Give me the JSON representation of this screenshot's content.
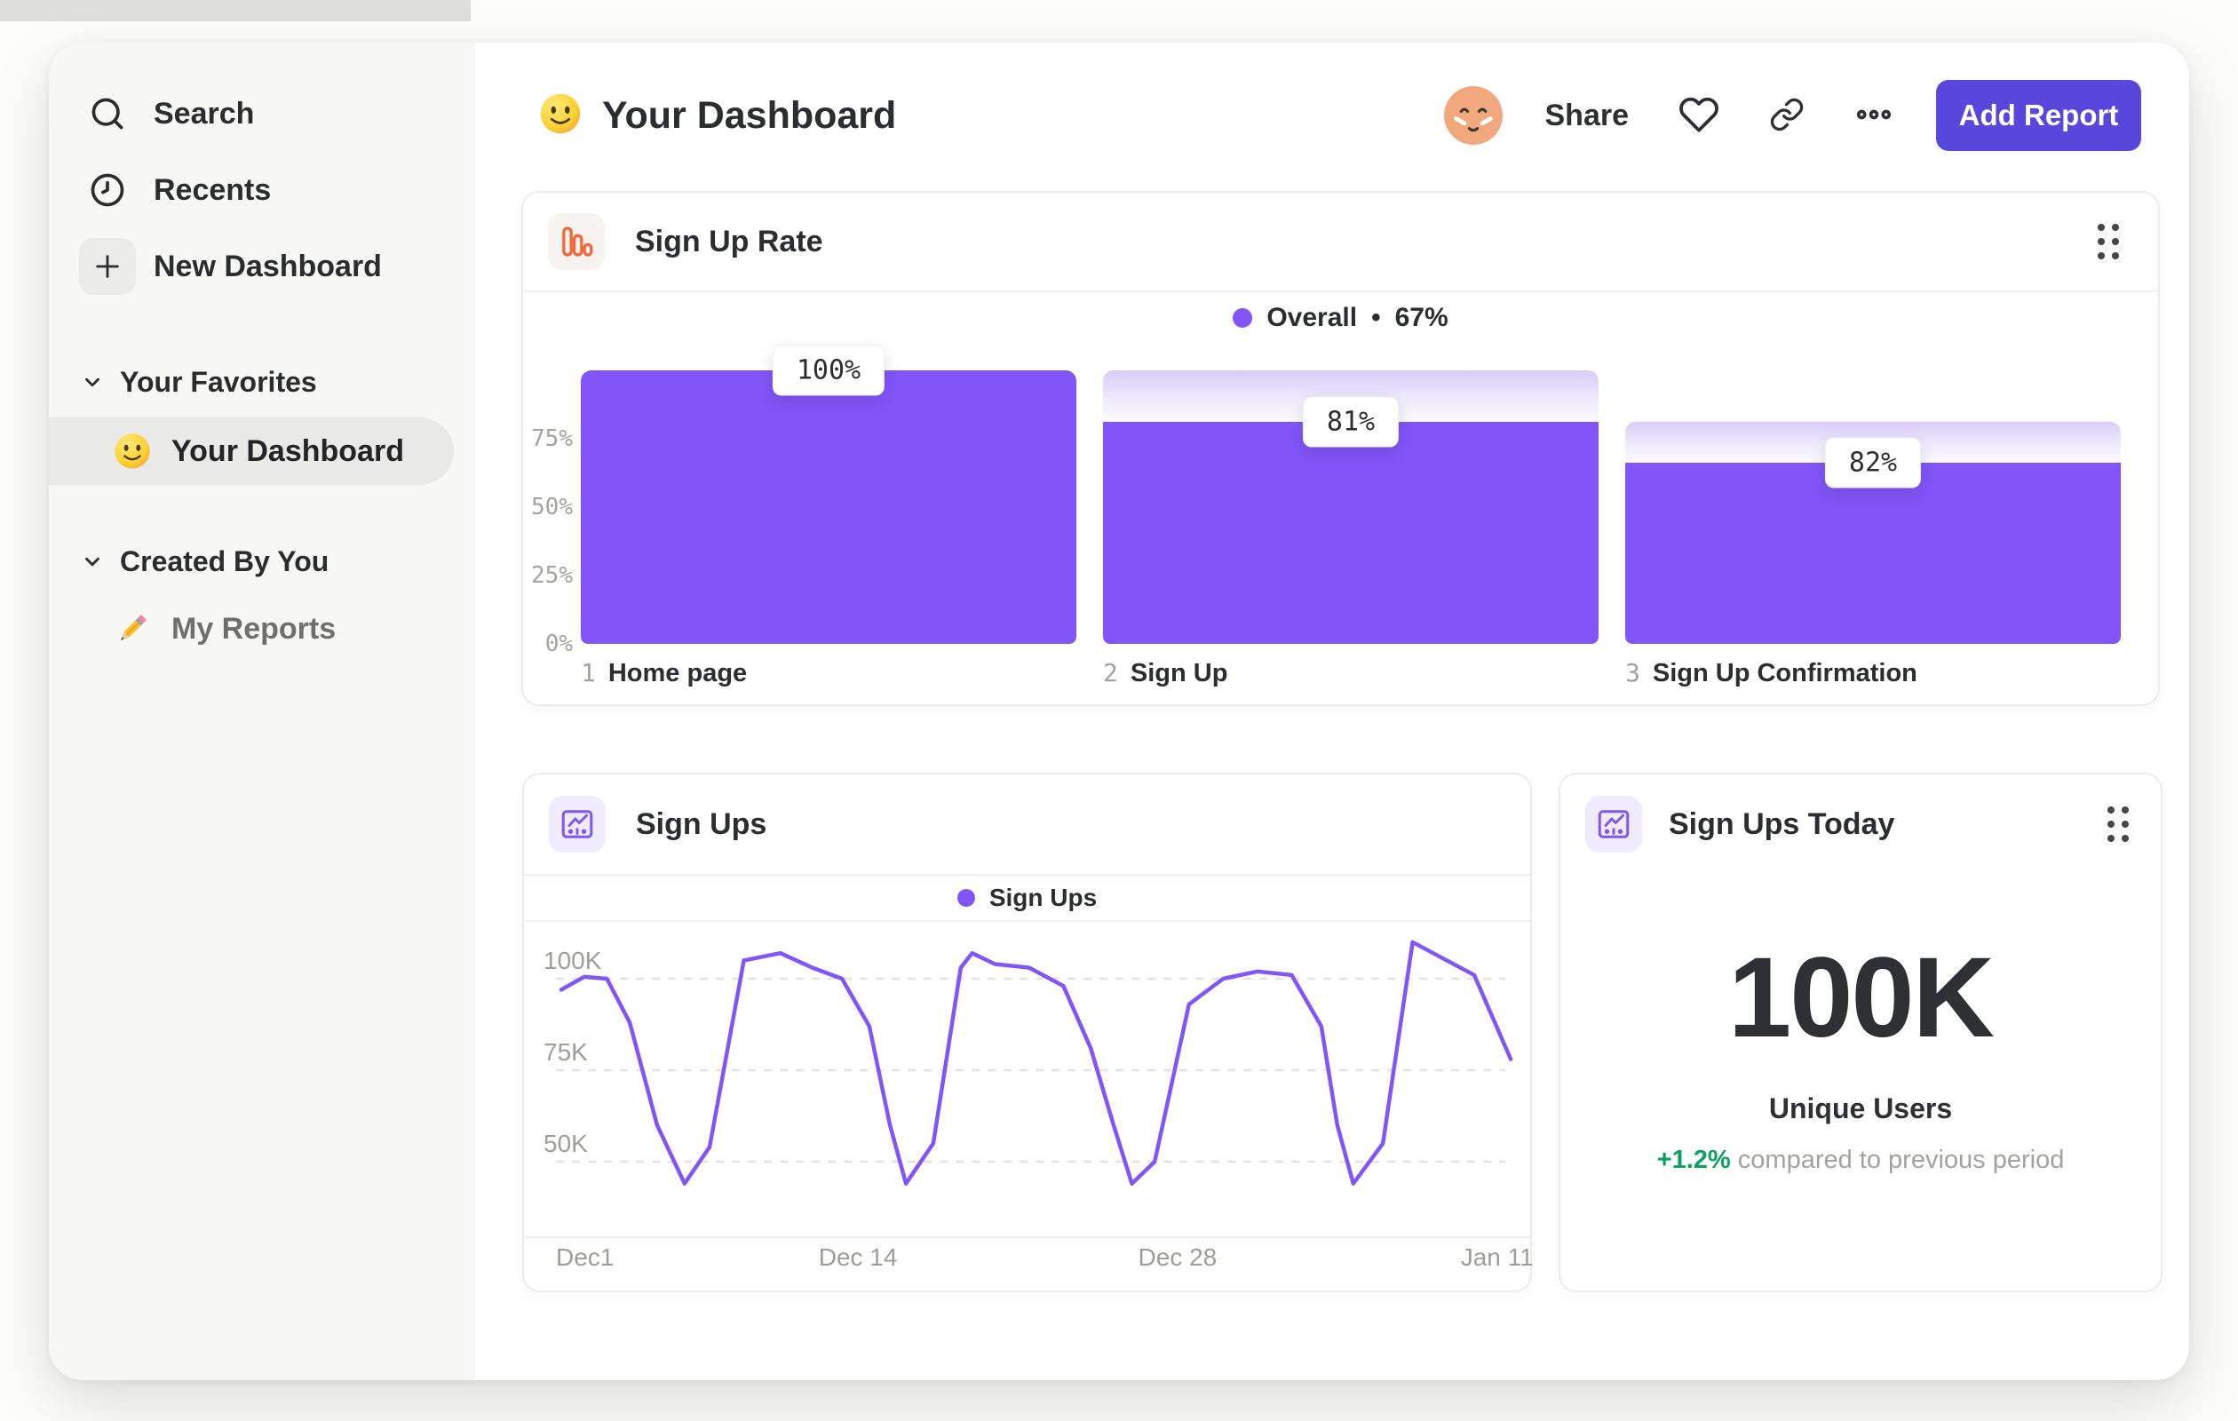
{
  "header": {
    "title": "Your Dashboard",
    "share_label": "Share",
    "add_report_label": "Add Report"
  },
  "sidebar": {
    "items": [
      {
        "label": "Search",
        "icon": "search-icon"
      },
      {
        "label": "Recents",
        "icon": "clock-icon"
      },
      {
        "label": "New Dashboard",
        "icon": "plus-icon"
      }
    ],
    "sections": [
      {
        "title": "Your Favorites",
        "items": [
          {
            "label": "Your Dashboard",
            "icon": "smiley-emoji",
            "selected": true
          }
        ]
      },
      {
        "title": "Created By You",
        "items": [
          {
            "label": "My Reports",
            "icon": "pencil-emoji",
            "selected": false
          }
        ]
      }
    ]
  },
  "cards": {
    "funnel": {
      "title": "Sign Up Rate",
      "legend": {
        "name": "Overall",
        "separator": "•",
        "value": "67%"
      }
    },
    "line": {
      "title": "Sign Ups",
      "legend": {
        "name": "Sign Ups"
      }
    },
    "metric": {
      "title": "Sign Ups Today",
      "value": "100K",
      "label": "Unique Users",
      "delta": "+1.2%",
      "delta_note": "compared to previous period"
    }
  },
  "chart_data": [
    {
      "type": "bar",
      "variant": "funnel",
      "title": "Sign Up Rate",
      "overall_conversion_pct": 67,
      "axis_max": 107,
      "y_ticks": [
        75,
        50,
        25,
        0
      ],
      "steps": [
        {
          "step": "1",
          "name": "Home page",
          "conversion_label": "100%",
          "abs_pct": 100,
          "prev_abs_pct": 100
        },
        {
          "step": "2",
          "name": "Sign Up",
          "conversion_label": "81%",
          "abs_pct": 81,
          "prev_abs_pct": 100
        },
        {
          "step": "3",
          "name": "Sign Up Confirmation",
          "conversion_label": "82%",
          "abs_pct": 66,
          "prev_abs_pct": 81
        }
      ]
    },
    {
      "type": "line",
      "title": "Sign Ups",
      "ylabel": "",
      "xlabel": "",
      "grid": "dashed-horizontal",
      "y_ticks": [
        {
          "value": 100,
          "label": "100K"
        },
        {
          "value": 75,
          "label": "75K"
        },
        {
          "value": 50,
          "label": "50K"
        }
      ],
      "x_ticks": [
        {
          "day": 0,
          "label": "Dec1"
        },
        {
          "day": 13,
          "label": "Dec 14"
        },
        {
          "day": 27,
          "label": "Dec 28"
        },
        {
          "day": 41,
          "label": "Jan 11"
        }
      ],
      "series": [
        {
          "name": "Sign Ups",
          "unit": "K",
          "points": [
            [
              0,
              97
            ],
            [
              1,
              100.5
            ],
            [
              2,
              100
            ],
            [
              3,
              88
            ],
            [
              4.2,
              60
            ],
            [
              5.4,
              44
            ],
            [
              6.5,
              54
            ],
            [
              8,
              105
            ],
            [
              9.6,
              107
            ],
            [
              11,
              103
            ],
            [
              12.3,
              100
            ],
            [
              13.5,
              87
            ],
            [
              14.4,
              60
            ],
            [
              15.1,
              44
            ],
            [
              16.3,
              55
            ],
            [
              17.5,
              103
            ],
            [
              18,
              107
            ],
            [
              19,
              104
            ],
            [
              20.5,
              103
            ],
            [
              22,
              98
            ],
            [
              23.2,
              81
            ],
            [
              24.2,
              60
            ],
            [
              25,
              44
            ],
            [
              26,
              50
            ],
            [
              27.5,
              93
            ],
            [
              29,
              100
            ],
            [
              30.5,
              102
            ],
            [
              32,
              101
            ],
            [
              33.3,
              87
            ],
            [
              34,
              60
            ],
            [
              34.7,
              44
            ],
            [
              36,
              55
            ],
            [
              37.3,
              110
            ],
            [
              38.5,
              106
            ],
            [
              40,
              101
            ],
            [
              41.6,
              78
            ]
          ]
        }
      ]
    }
  ],
  "colors": {
    "accent_purple": "#8155f8",
    "button_indigo": "#5846dd",
    "funnel_icon_orange": "#f2683a",
    "delta_green": "#0ba15e",
    "grid_gray": "#e3e3e1"
  }
}
